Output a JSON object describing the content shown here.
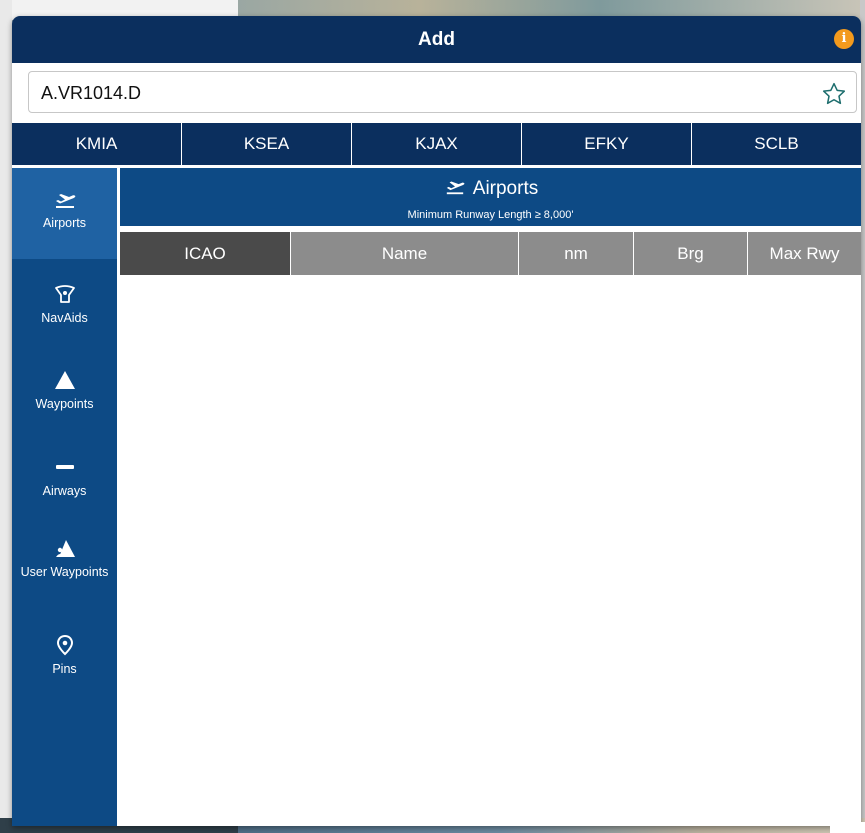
{
  "dialog": {
    "title": "Add",
    "info_icon": "info-icon",
    "info_glyph": "i",
    "accent_color": "#f39a1d"
  },
  "search": {
    "value": "A.VR1014.D",
    "favorite_icon": "star-outline-icon"
  },
  "recent_tabs": [
    "KMIA",
    "KSEA",
    "KJAX",
    "EFKY",
    "SCLB"
  ],
  "sidebar": {
    "items": [
      {
        "label": "Airports",
        "icon": "airplane-departure-icon",
        "active": true
      },
      {
        "label": "NavAids",
        "icon": "navaid-icon",
        "active": false
      },
      {
        "label": "Waypoints",
        "icon": "triangle-icon",
        "active": false
      },
      {
        "label": "Airways",
        "icon": "airway-icon",
        "active": false
      },
      {
        "label": "User Waypoints",
        "icon": "user-waypoint-icon",
        "active": false
      },
      {
        "label": "Pins",
        "icon": "map-pin-icon",
        "active": false
      }
    ]
  },
  "content": {
    "title": "Airports",
    "subtitle": "Minimum Runway Length ≥ 8,000'",
    "columns": [
      {
        "label": "ICAO",
        "active": true
      },
      {
        "label": "Name",
        "active": false
      },
      {
        "label": "nm",
        "active": false
      },
      {
        "label": "Brg",
        "active": false
      },
      {
        "label": "Max Rwy",
        "active": false
      }
    ],
    "rows": []
  },
  "colors": {
    "titlebar": "#0b2f5e",
    "sidebar": "#0d4a85",
    "sidebar_active": "#1f62a3",
    "column_header": "#8c8c8c",
    "column_header_active": "#4a4a4a"
  }
}
